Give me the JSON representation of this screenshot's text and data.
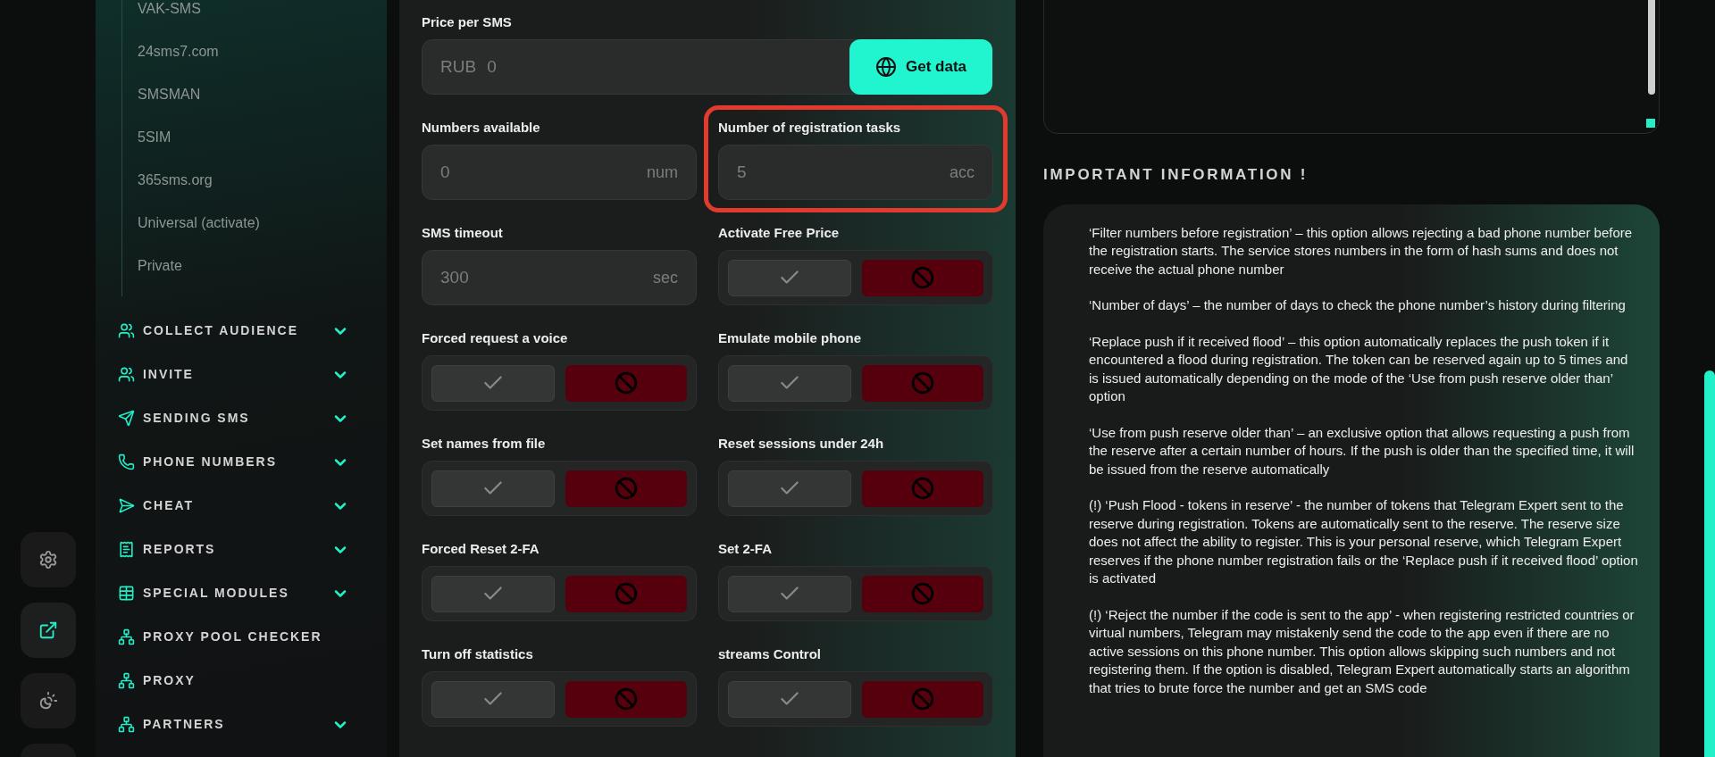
{
  "rail": [
    {
      "selected": false
    },
    {
      "selected": true
    },
    {
      "selected": false
    }
  ],
  "sidebar": {
    "subitems": [
      "VAK-SMS",
      "24sms7.com",
      "SMSMAN",
      "5SIM",
      "365sms.org",
      "Universal (activate)",
      "Private"
    ],
    "sections": [
      {
        "label": "COLLECT AUDIENCE",
        "has_submenu": true
      },
      {
        "label": "INVITE",
        "has_submenu": true
      },
      {
        "label": "SENDING SMS",
        "has_submenu": true
      },
      {
        "label": "PHONE NUMBERS",
        "has_submenu": true
      },
      {
        "label": "CHEAT",
        "has_submenu": true
      },
      {
        "label": "REPORTS",
        "has_submenu": true
      },
      {
        "label": "SPECIAL MODULES",
        "has_submenu": true
      },
      {
        "label": "PROXY POOL CHECKER",
        "has_submenu": false
      },
      {
        "label": "PROXY",
        "has_submenu": false
      },
      {
        "label": "PARTNERS",
        "has_submenu": true
      }
    ]
  },
  "form": {
    "price": {
      "label": "Price per SMS",
      "currency": "RUB",
      "value": "0",
      "button": "Get data"
    },
    "fields": [
      {
        "kind": "input",
        "label": "Numbers available",
        "value": "0",
        "unit": "num",
        "highlighted": false
      },
      {
        "kind": "input",
        "label": "Number of registration tasks",
        "value": "5",
        "unit": "acc",
        "highlighted": true
      },
      {
        "kind": "input",
        "label": "SMS timeout",
        "value": "300",
        "unit": "sec",
        "highlighted": false
      },
      {
        "kind": "toggle",
        "label": "Activate Free Price",
        "enabled": false
      },
      {
        "kind": "toggle",
        "label": "Forced request a voice",
        "enabled": false
      },
      {
        "kind": "toggle",
        "label": "Emulate mobile phone",
        "enabled": false
      },
      {
        "kind": "toggle",
        "label": "Set names from file",
        "enabled": false
      },
      {
        "kind": "toggle",
        "label": "Reset sessions under 24h",
        "enabled": false
      },
      {
        "kind": "toggle",
        "label": "Forced Reset 2-FA",
        "enabled": false
      },
      {
        "kind": "toggle",
        "label": "Set 2-FA",
        "enabled": false
      },
      {
        "kind": "toggle",
        "label": "Turn off statistics",
        "enabled": false
      },
      {
        "kind": "toggle",
        "label": "streams Control",
        "enabled": false
      }
    ]
  },
  "info": {
    "title": "IMPORTANT INFORMATION !",
    "paragraphs": [
      "‘Filter numbers before registration’ – this option allows rejecting a bad phone number before the registration starts. The service stores numbers in the form of hash sums and does not receive the actual phone number",
      "‘Number of days’ – the number of days to check the phone number’s history during filtering",
      "‘Replace push if it received flood’ – this option automatically replaces the push token if it encountered a flood during registration. The token can be reserved again up to 5 times and is issued automatically depending on the mode of the ‘Use from push reserve older than’ option",
      "‘Use from push reserve older than’ – an exclusive option that allows requesting a push from the reserve after a certain number of hours. If the push is older than the specified time, it will be issued from the reserve automatically",
      "(!) ‘Push Flood - tokens in reserve’ - the number of tokens that Telegram Expert sent to the reserve during registration. Tokens are automatically sent to the reserve. The reserve size does not affect the ability to register. This is your personal reserve, which Telegram Expert reserves if the phone number registration fails or the ‘Replace push if it received flood’ option is activated",
      "(!) ‘Reject the number if the code is sent to the app’ - when registering restricted countries or virtual numbers, Telegram may mistakenly send the code to the app even if there are no active sessions on this phone number. This option allows skipping such numbers and not registering them. If the option is disabled, Telegram Expert automatically starts an algorithm that tries to brute force the number and get an SMS code"
    ]
  }
}
